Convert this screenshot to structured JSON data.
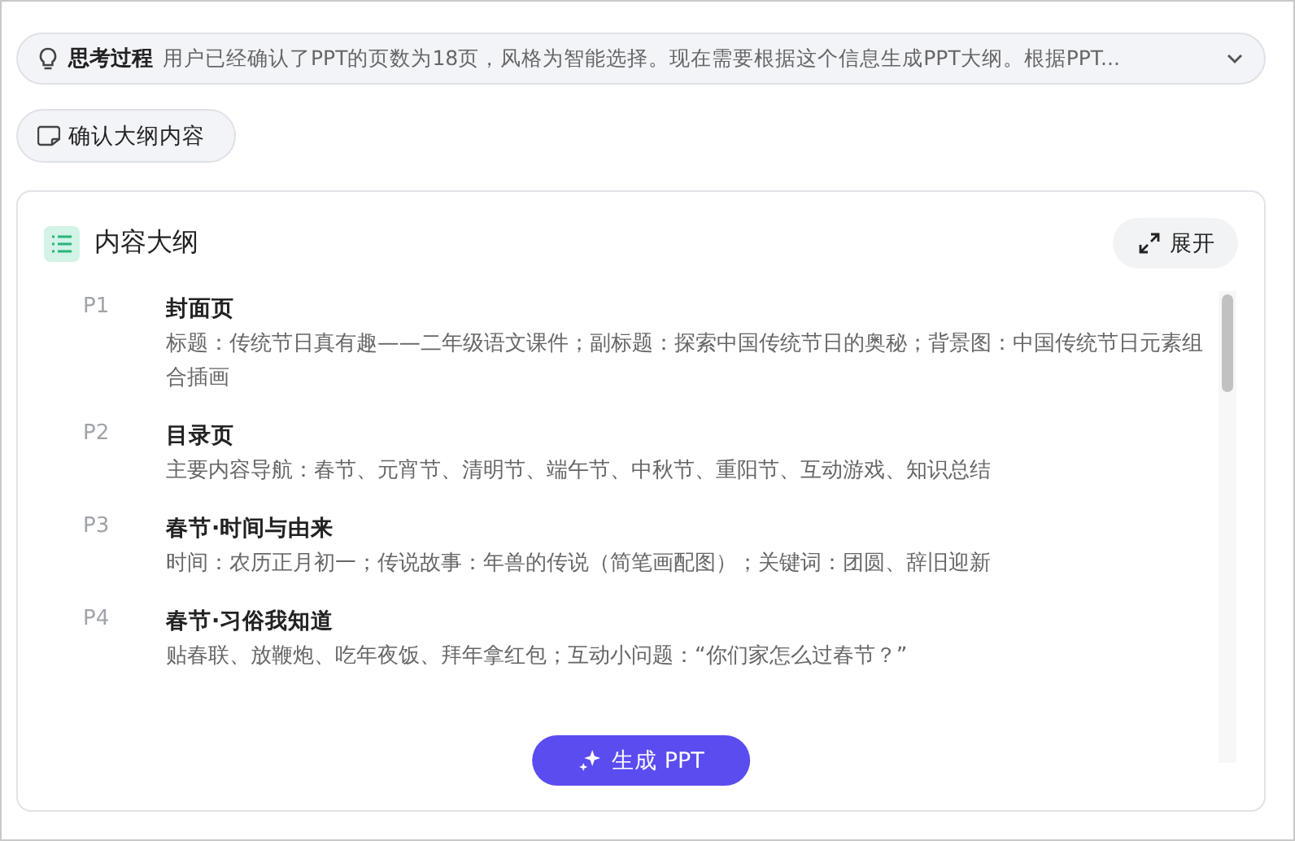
{
  "thinking": {
    "label": "思考过程",
    "summary": "用户已经确认了PPT的页数为18页，风格为智能选择。现在需要根据这个信息生成PPT大纲。根据PPT...",
    "expanded": false
  },
  "confirm_chip": {
    "label": "确认大纲内容"
  },
  "outline": {
    "title": "内容大纲",
    "expand_button": "展开",
    "items": [
      {
        "page": "P1",
        "title": "封面页",
        "description": "标题：传统节日真有趣——二年级语文课件；副标题：探索中国传统节日的奥秘；背景图：中国传统节日元素组合插画"
      },
      {
        "page": "P2",
        "title": "目录页",
        "description": "主要内容导航：春节、元宵节、清明节、端午节、中秋节、重阳节、互动游戏、知识总结"
      },
      {
        "page": "P3",
        "title": "春节·时间与由来",
        "description": "时间：农历正月初一；传说故事：年兽的传说（简笔画配图）；关键词：团圆、辞旧迎新"
      },
      {
        "page": "P4",
        "title": "春节·习俗我知道",
        "description": "贴春联、放鞭炮、吃年夜饭、拜年拿红包；互动小问题：“你们家怎么过春节？”"
      }
    ],
    "generate_button": "生成 PPT"
  }
}
